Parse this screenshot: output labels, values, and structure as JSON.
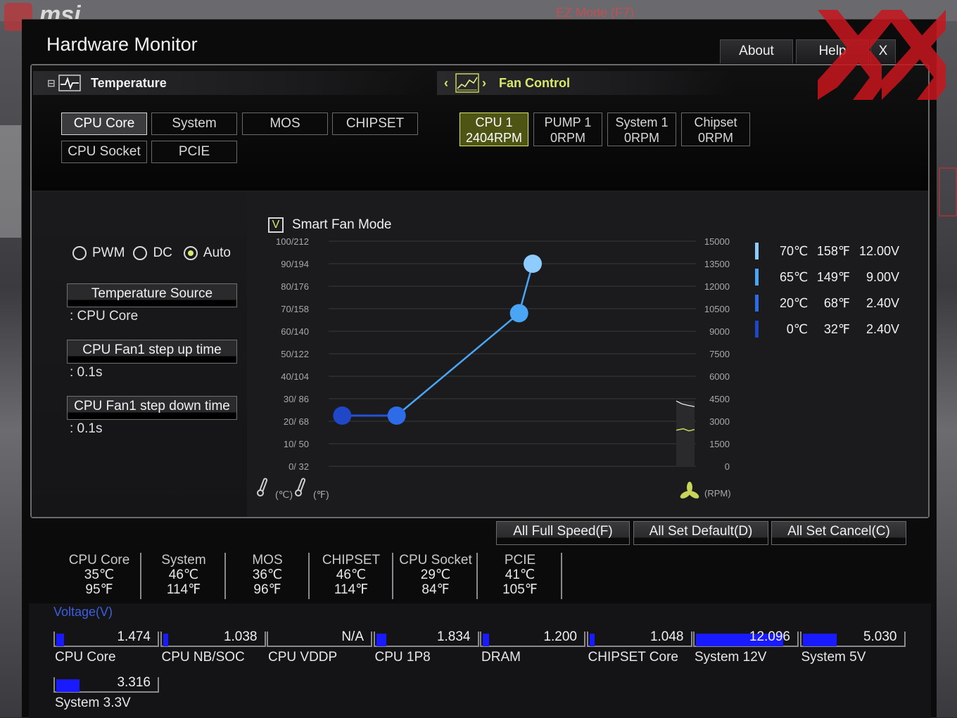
{
  "window": {
    "title": "Hardware Monitor"
  },
  "topbar": {
    "about": "About",
    "help": "Help",
    "close": "X"
  },
  "background": {
    "brand": "msi",
    "ez_mode": "EZ Mode (F7)"
  },
  "temperature": {
    "header": "Temperature",
    "sources": [
      "CPU Core",
      "System",
      "MOS",
      "CHIPSET",
      "CPU Socket",
      "PCIE"
    ],
    "active": "CPU Core"
  },
  "fan_control": {
    "header": "Fan Control",
    "nav_left": "‹",
    "nav_right": "›",
    "fans": [
      {
        "name": "CPU 1",
        "rpm": "2404RPM",
        "active": true
      },
      {
        "name": "PUMP 1",
        "rpm": "0RPM",
        "active": false
      },
      {
        "name": "System 1",
        "rpm": "0RPM",
        "active": false
      },
      {
        "name": "Chipset",
        "rpm": "0RPM",
        "active": false
      }
    ]
  },
  "mode": {
    "options": [
      "PWM",
      "DC",
      "Auto"
    ],
    "selected": "Auto"
  },
  "settings": {
    "temp_source_label": "Temperature Source",
    "temp_source_value": ": CPU Core",
    "step_up_label": "CPU Fan1 step up time",
    "step_up_value": ": 0.1s",
    "step_down_label": "CPU Fan1 step down time",
    "step_down_value": ": 0.1s"
  },
  "smart_fan": {
    "label": "Smart Fan Mode",
    "checked": true,
    "check_mark": "V"
  },
  "chart_data": {
    "type": "line",
    "y_left_ticks": [
      "100/212",
      "90/194",
      "80/176",
      "70/158",
      "60/140",
      "50/122",
      "40/104",
      "30/ 86",
      "20/ 68",
      "10/ 50",
      "0/ 32"
    ],
    "y_right_ticks": [
      "15000",
      "13500",
      "12000",
      "10500",
      "9000",
      "7500",
      "6000",
      "4500",
      "3000",
      "1500",
      "0"
    ],
    "x_unit_c": "(℃)",
    "x_unit_f": "(℉)",
    "y_right_unit": "(RPM)",
    "curve_points": [
      {
        "temp_c": 0,
        "speed_pct": 22.5
      },
      {
        "temp_c": 20,
        "speed_pct": 22.5
      },
      {
        "temp_c": 65,
        "speed_pct": 68
      },
      {
        "temp_c": 70,
        "speed_pct": 90
      }
    ],
    "ylim": [
      0,
      100
    ],
    "xlim": [
      -5,
      130
    ],
    "current_rpm": 2404
  },
  "curve_legend": [
    {
      "c": "70℃",
      "f": "158℉",
      "v": "12.00V",
      "color": "#8ecbff"
    },
    {
      "c": "65℃",
      "f": "149℉",
      "v": "9.00V",
      "color": "#4aa6f5"
    },
    {
      "c": "20℃",
      "f": "68℉",
      "v": "2.40V",
      "color": "#2d6ce6"
    },
    {
      "c": "0℃",
      "f": "32℉",
      "v": "2.40V",
      "color": "#1f47c8"
    }
  ],
  "actions": {
    "full_speed": "All Full Speed(F)",
    "set_default": "All Set Default(D)",
    "set_cancel": "All Set Cancel(C)"
  },
  "temps": [
    {
      "name": "CPU Core",
      "c": "35℃",
      "f": "95℉"
    },
    {
      "name": "System",
      "c": "46℃",
      "f": "114℉"
    },
    {
      "name": "MOS",
      "c": "36℃",
      "f": "96℉"
    },
    {
      "name": "CHIPSET",
      "c": "46℃",
      "f": "114℉"
    },
    {
      "name": "CPU Socket",
      "c": "29℃",
      "f": "84℉"
    },
    {
      "name": "PCIE",
      "c": "41℃",
      "f": "105℉"
    }
  ],
  "voltage": {
    "title": "Voltage(V)",
    "rails": [
      {
        "name": "CPU Core",
        "value": "1.474",
        "fill_pct": 8
      },
      {
        "name": "CPU NB/SOC",
        "value": "1.038",
        "fill_pct": 5
      },
      {
        "name": "CPU VDDP",
        "value": "N/A",
        "fill_pct": 0
      },
      {
        "name": "CPU 1P8",
        "value": "1.834",
        "fill_pct": 10
      },
      {
        "name": "DRAM",
        "value": "1.200",
        "fill_pct": 6
      },
      {
        "name": "CHIPSET Core",
        "value": "1.048",
        "fill_pct": 5
      },
      {
        "name": "System 12V",
        "value": "12.096",
        "fill_pct": 87
      },
      {
        "name": "System 5V",
        "value": "5.030",
        "fill_pct": 34
      },
      {
        "name": "System 3.3V",
        "value": "3.316",
        "fill_pct": 23
      }
    ]
  }
}
